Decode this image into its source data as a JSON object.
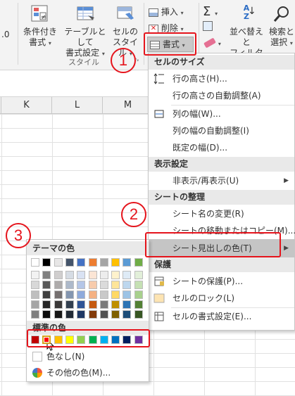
{
  "ribbon": {
    "partial_value": ".0",
    "conditional_format": {
      "line1": "条件付き",
      "line2": "書式"
    },
    "format_as_table": {
      "line1": "テーブルとして",
      "line2": "書式設定"
    },
    "cell_style": {
      "line1": "セルの",
      "line2": "スタイル"
    },
    "styles_group": "スタイル",
    "insert": "挿入",
    "delete": "削除",
    "format": "書式",
    "sort_filter": {
      "line1": "並べ替えと",
      "line2": "フィルター"
    },
    "find_select": {
      "line1": "検索と",
      "line2": "選択"
    }
  },
  "columns": [
    "K",
    "L",
    "M"
  ],
  "callouts": [
    "1",
    "2",
    "3"
  ],
  "menu": {
    "cell_size": {
      "heading": "セルのサイズ",
      "row_height": "行の高さ(H)...",
      "autofit_row": "行の高さの自動調整(A)",
      "column_width": "列の幅(W)...",
      "autofit_column": "列の幅の自動調整(I)",
      "default_width": "既定の幅(D)..."
    },
    "visibility": {
      "heading": "表示設定",
      "hide_unhide": "非表示/再表示(U)"
    },
    "organize": {
      "heading": "シートの整理",
      "rename": "シート名の変更(R)",
      "move_copy": "シートの移動またはコピー(M)...",
      "tab_color": "シート見出しの色(T)"
    },
    "protection": {
      "heading": "保護",
      "protect_sheet": "シートの保護(P)...",
      "lock_cell": "セルのロック(L)",
      "format_cells": "セルの書式設定(E)..."
    }
  },
  "palette": {
    "theme_heading": "テーマの色",
    "standard_heading": "標準の色",
    "no_color": "色なし(N)",
    "more_colors": "その他の色(M)...",
    "theme_top": [
      "#ffffff",
      "#000000",
      "#e7e6e6",
      "#44546a",
      "#4472c4",
      "#ed7d31",
      "#a5a5a5",
      "#ffc000",
      "#5b9bd5",
      "#70ad47"
    ],
    "theme_shades": [
      [
        "#f2f2f2",
        "#7f7f7f",
        "#d0cece",
        "#d6dce4",
        "#d9e2f3",
        "#fbe5d5",
        "#ededed",
        "#fff2cc",
        "#deebf6",
        "#e2efd9"
      ],
      [
        "#d8d8d8",
        "#595959",
        "#aeabab",
        "#adb9ca",
        "#b4c6e7",
        "#f7cbac",
        "#dbdbdb",
        "#fee599",
        "#bdd7ee",
        "#c5e0b3"
      ],
      [
        "#bfbfbf",
        "#3f3f3f",
        "#757070",
        "#8496b0",
        "#8eaadb",
        "#f4b183",
        "#c9c9c9",
        "#ffd965",
        "#9cc3e5",
        "#a8d08d"
      ],
      [
        "#a5a5a5",
        "#262626",
        "#3a3838",
        "#323f4f",
        "#2f5496",
        "#c55a11",
        "#7b7b7b",
        "#bf8f00",
        "#2e75b5",
        "#538135"
      ],
      [
        "#7f7f7f",
        "#0c0c0c",
        "#171616",
        "#222a35",
        "#1f3864",
        "#833c0b",
        "#525252",
        "#7f6000",
        "#1e4e79",
        "#375623"
      ]
    ],
    "standard": [
      "#c00000",
      "#ff0000",
      "#ffc000",
      "#ffff00",
      "#92d050",
      "#00b050",
      "#00b0f0",
      "#0070c0",
      "#002060",
      "#7030a0"
    ]
  },
  "colors": {
    "accent_red": "#e5141c",
    "highlight": "#c5c5c5",
    "heading_bg": "#e9e9e9"
  }
}
